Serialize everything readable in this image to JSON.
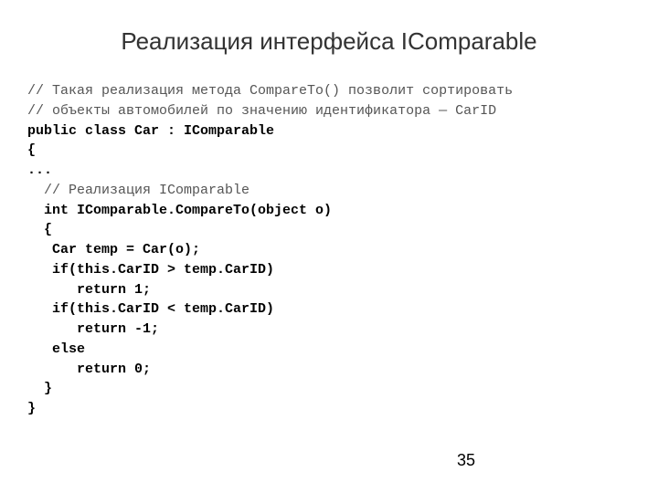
{
  "title": "Реализация интерфейса IComparable",
  "code": {
    "c1": "// Такая реализация метода CompareTo() позволит сортировать",
    "c2": "// объекты автомобилей по значению идентификатора — CarID",
    "c3": "public class Car : IComparable",
    "c4": "{",
    "c5": "...",
    "c6": "  // Реализация IComparable",
    "c7": "  int IComparable.CompareTo(object o)",
    "c8": "  {",
    "c9": "   Car temp = Car(o);",
    "c10": "   if(this.CarID > temp.CarID)",
    "c11": "      return 1;",
    "c12": "   if(this.CarID < temp.CarID)",
    "c13": "      return -1;",
    "c14": "   else",
    "c15": "      return 0;",
    "c16": "  }",
    "c17": "}"
  },
  "pageNumber": "35"
}
